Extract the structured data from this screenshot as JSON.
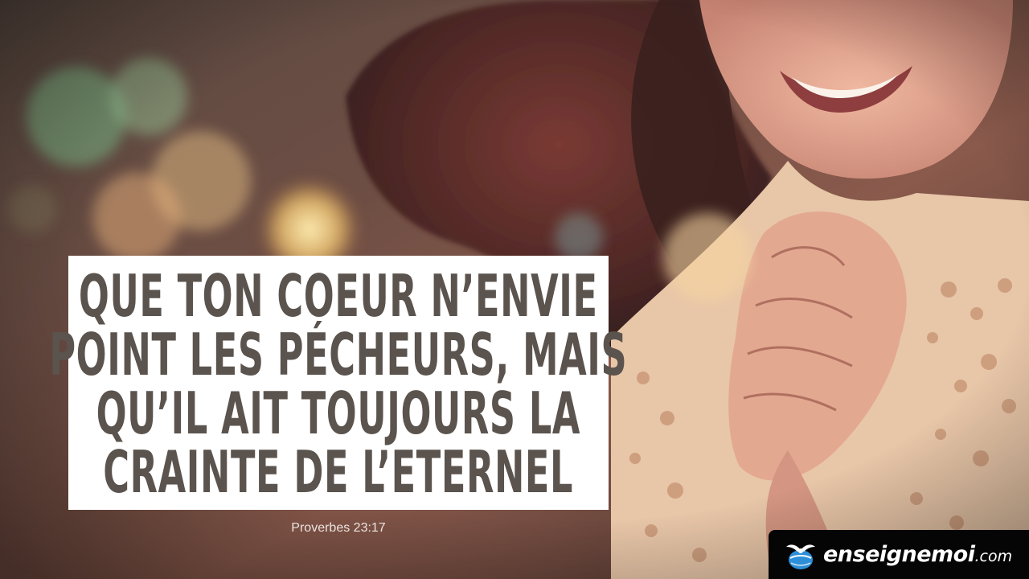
{
  "quote": {
    "lines": [
      "QUE TON COEUR N’ENVIE",
      "POINT LES PÉCHEURS, MAIS",
      "QU’IL AIT TOUJOURS LA",
      "CRAINTE DE L’ETERNEL"
    ]
  },
  "reference": "Proverbes 23:17",
  "brand": {
    "name": "enseignemoi",
    "suffix": ".com",
    "icon": "globe-dove-logo-icon",
    "background_color": "#050505",
    "icon_color": "#2d8fd8"
  },
  "colors": {
    "quote_text": "#5b534d",
    "quote_background": "#ffffff",
    "reference_text": "#ebe3e0"
  }
}
